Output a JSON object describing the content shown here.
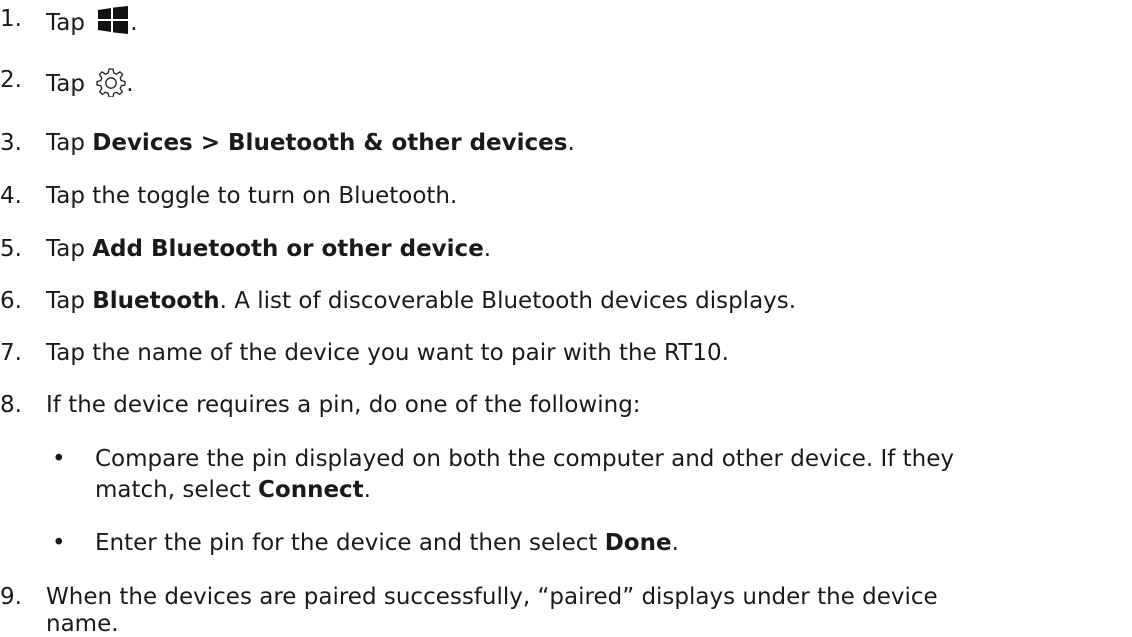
{
  "steps": [
    {
      "num": "1.",
      "pre": "Tap",
      "icon": "windows-start-icon",
      "post": "."
    },
    {
      "num": "2.",
      "pre": "Tap",
      "icon": "settings-gear-icon",
      "post": "."
    },
    {
      "num": "3.",
      "pre": "Tap ",
      "bold": "Devices > Bluetooth & other devices",
      "post": "."
    },
    {
      "num": "4.",
      "text": "Tap the toggle to turn on Bluetooth."
    },
    {
      "num": "5.",
      "pre": "Tap ",
      "bold": "Add Bluetooth or other device",
      "post": "."
    },
    {
      "num": "6.",
      "pre": "Tap ",
      "bold": "Bluetooth",
      "post": ". A list of discoverable Bluetooth devices displays."
    },
    {
      "num": "7.",
      "text": "Tap the name of the device you want to pair with the RT10."
    },
    {
      "num": "8.",
      "text": "If the device requires a pin, do one of the following:"
    },
    {
      "num": "9.",
      "line1": "When the devices are paired successfully, “paired” displays under the device",
      "line2": "name."
    }
  ],
  "bullets": [
    {
      "glyph": "•",
      "line1": "Compare the pin displayed on both the computer and other device. If they",
      "line2_pre": "match, select ",
      "line2_bold": "Connect",
      "line2_post": "."
    },
    {
      "glyph": "•",
      "pre": "Enter the pin for the device and then select ",
      "bold": "Done",
      "post": "."
    }
  ]
}
